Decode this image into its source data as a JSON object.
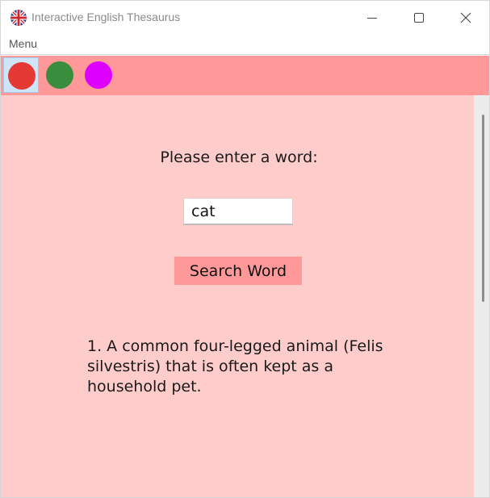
{
  "window": {
    "title": "Interactive English Thesaurus",
    "icon": "uk-flag-icon"
  },
  "menubar": {
    "items": [
      {
        "label": "Menu"
      }
    ]
  },
  "toolbar": {
    "color_buttons": [
      {
        "name": "red",
        "color": "#e53935",
        "selected": true
      },
      {
        "name": "green",
        "color": "#388e3c",
        "selected": false
      },
      {
        "name": "magenta",
        "color": "#dd00ff",
        "selected": false
      }
    ],
    "background": "#ff9999"
  },
  "main": {
    "background": "#ffcccc",
    "prompt": "Please enter a word:",
    "word_input": {
      "value": "cat",
      "placeholder": ""
    },
    "search_button_label": "Search Word",
    "definition": "1. A common four-legged animal (Felis silvestris) that is often kept as a household pet."
  }
}
